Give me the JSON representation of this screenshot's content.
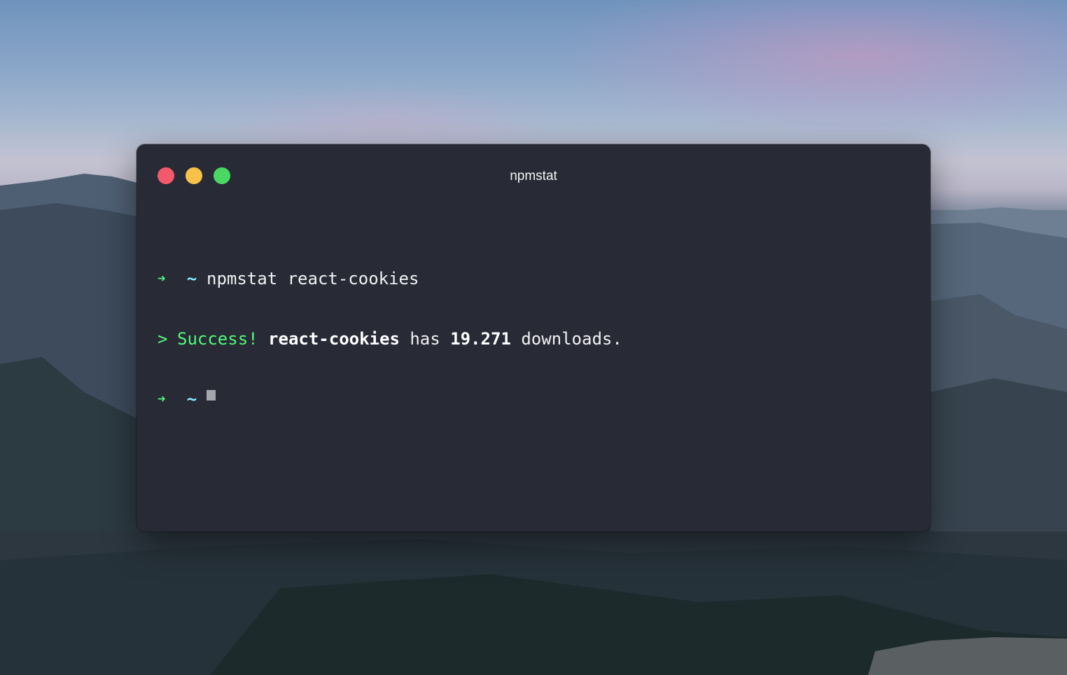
{
  "window": {
    "title": "npmstat"
  },
  "terminal": {
    "prompt_symbol": "➜",
    "cwd": "~",
    "command": "npmstat react-cookies",
    "output_marker": ">",
    "output_success": "Success!",
    "output_package": "react-cookies",
    "output_has": "has",
    "output_count": "19.271",
    "output_suffix": "downloads."
  },
  "colors": {
    "window_bg": "#282a36",
    "prompt_green": "#50fa7b",
    "cwd_cyan": "#8be9fd",
    "close": "#f25a6c",
    "minimize": "#f8c24a",
    "zoom": "#4ad763"
  }
}
